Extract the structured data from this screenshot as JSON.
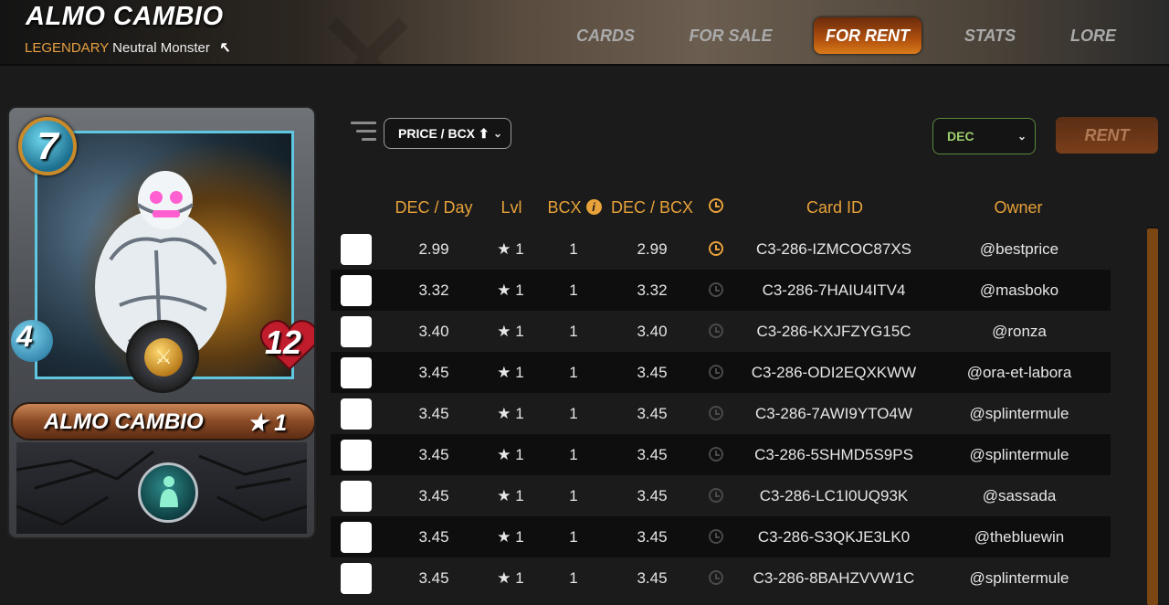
{
  "header": {
    "title": "ALMO CAMBIO",
    "rarity": "LEGENDARY",
    "type_text": "Neutral Monster",
    "nav": [
      {
        "label": "CARDS",
        "active": false
      },
      {
        "label": "FOR SALE",
        "active": false
      },
      {
        "label": "FOR RENT",
        "active": true
      },
      {
        "label": "STATS",
        "active": false
      },
      {
        "label": "LORE",
        "active": false
      }
    ]
  },
  "card": {
    "name": "ALMO CAMBIO",
    "level": "★ 1",
    "mana": "7",
    "speed": "4",
    "health": "12",
    "attack_icon": "crossed-swords-icon",
    "ability_icon": "mimic-ability-icon"
  },
  "controls": {
    "sort_select": "PRICE / BCX ⬆",
    "currency_select": "DEC",
    "rent_button": "RENT"
  },
  "table": {
    "headers": {
      "dec_day": "DEC / Day",
      "lvl": "Lvl",
      "bcx": "BCX",
      "dec_bcx": "DEC / BCX",
      "card_id": "Card ID",
      "owner": "Owner"
    },
    "rows": [
      {
        "dec_day": "2.99",
        "lvl": "★ 1",
        "bcx": "1",
        "dec_bcx": "2.99",
        "card_id": "C3-286-IZMCOC87XS",
        "owner": "@bestprice",
        "clock_active": true
      },
      {
        "dec_day": "3.32",
        "lvl": "★ 1",
        "bcx": "1",
        "dec_bcx": "3.32",
        "card_id": "C3-286-7HAIU4ITV4",
        "owner": "@masboko",
        "clock_active": false
      },
      {
        "dec_day": "3.40",
        "lvl": "★ 1",
        "bcx": "1",
        "dec_bcx": "3.40",
        "card_id": "C3-286-KXJFZYG15C",
        "owner": "@ronza",
        "clock_active": false
      },
      {
        "dec_day": "3.45",
        "lvl": "★ 1",
        "bcx": "1",
        "dec_bcx": "3.45",
        "card_id": "C3-286-ODI2EQXKWW",
        "owner": "@ora-et-labora",
        "clock_active": false
      },
      {
        "dec_day": "3.45",
        "lvl": "★ 1",
        "bcx": "1",
        "dec_bcx": "3.45",
        "card_id": "C3-286-7AWI9YTO4W",
        "owner": "@splintermule",
        "clock_active": false
      },
      {
        "dec_day": "3.45",
        "lvl": "★ 1",
        "bcx": "1",
        "dec_bcx": "3.45",
        "card_id": "C3-286-5SHMD5S9PS",
        "owner": "@splintermule",
        "clock_active": false
      },
      {
        "dec_day": "3.45",
        "lvl": "★ 1",
        "bcx": "1",
        "dec_bcx": "3.45",
        "card_id": "C3-286-LC1I0UQ93K",
        "owner": "@sassada",
        "clock_active": false
      },
      {
        "dec_day": "3.45",
        "lvl": "★ 1",
        "bcx": "1",
        "dec_bcx": "3.45",
        "card_id": "C3-286-S3QKJE3LK0",
        "owner": "@thebluewin",
        "clock_active": false
      },
      {
        "dec_day": "3.45",
        "lvl": "★ 1",
        "bcx": "1",
        "dec_bcx": "3.45",
        "card_id": "C3-286-8BAHZVVW1C",
        "owner": "@splintermule",
        "clock_active": false
      }
    ]
  },
  "colors": {
    "accent": "#e8a23a",
    "clock_active": "#e8a23a",
    "clock_inactive": "#4a4a4a",
    "nav_active": "#b0500e"
  }
}
